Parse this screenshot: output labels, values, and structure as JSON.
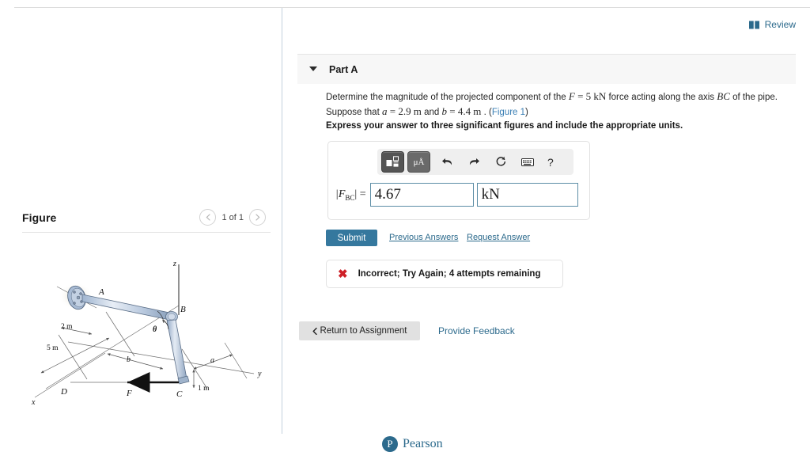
{
  "header": {
    "review_label": "Review",
    "review_icon": "book-icon"
  },
  "figure_panel": {
    "title": "Figure",
    "prev_icon": "chevron-left-icon",
    "next_icon": "chevron-right-icon",
    "counter": "1 of 1",
    "diagram": {
      "axis_labels": [
        "z",
        "y",
        "x"
      ],
      "point_labels": [
        "A",
        "B",
        "C",
        "D",
        "F"
      ],
      "angle_label": "θ",
      "dimension_labels": [
        "2 m",
        "5 m",
        "b",
        "a",
        "1 m"
      ]
    }
  },
  "part": {
    "collapse_icon": "caret-down-icon",
    "title": "Part A",
    "prompt_pre": "Determine the magnitude of the projected component of the ",
    "prompt_F": "F",
    "prompt_eq1": " = 5",
    "prompt_kN": "kN",
    "prompt_mid": " force acting along the axis ",
    "prompt_BC": "BC",
    "prompt_post": " of the pipe. Suppose that ",
    "prompt_a": "a",
    "prompt_aval": " = 2.9",
    "prompt_m1": "m",
    "prompt_and": " and ",
    "prompt_b": "b",
    "prompt_bval": " = 4.4",
    "prompt_m2": "m",
    "prompt_dot": " . (",
    "figure_link": "Figure 1",
    "prompt_close": ")",
    "instruction": "Express your answer to three significant figures and include the appropriate units."
  },
  "answer": {
    "toolbar": {
      "template_button": "template-icon",
      "units_button": "μÅ",
      "undo_icon": "undo-icon",
      "redo_icon": "redo-icon",
      "reset_icon": "reset-icon",
      "keyboard_icon": "keyboard-icon",
      "help_icon": "?"
    },
    "variable_label": "|F",
    "variable_sub": "BC",
    "variable_suffix": "| =",
    "value": "4.67",
    "unit": "kN"
  },
  "actions": {
    "submit_label": "Submit",
    "previous_answers_label": "Previous Answers",
    "request_answer_label": "Request Answer"
  },
  "feedback": {
    "status_icon": "x-mark-icon",
    "message": "Incorrect; Try Again; 4 attempts remaining"
  },
  "footer": {
    "return_icon": "chevron-left-icon",
    "return_label": "Return to Assignment",
    "provide_feedback_label": "Provide Feedback",
    "brand_mark": "P",
    "brand_name": "Pearson"
  },
  "colors": {
    "accent": "#2c6a8c",
    "submit": "#35789e",
    "error": "#ce2027",
    "input_border": "#5d8ea6",
    "panel_bg": "#f7f7f7"
  }
}
